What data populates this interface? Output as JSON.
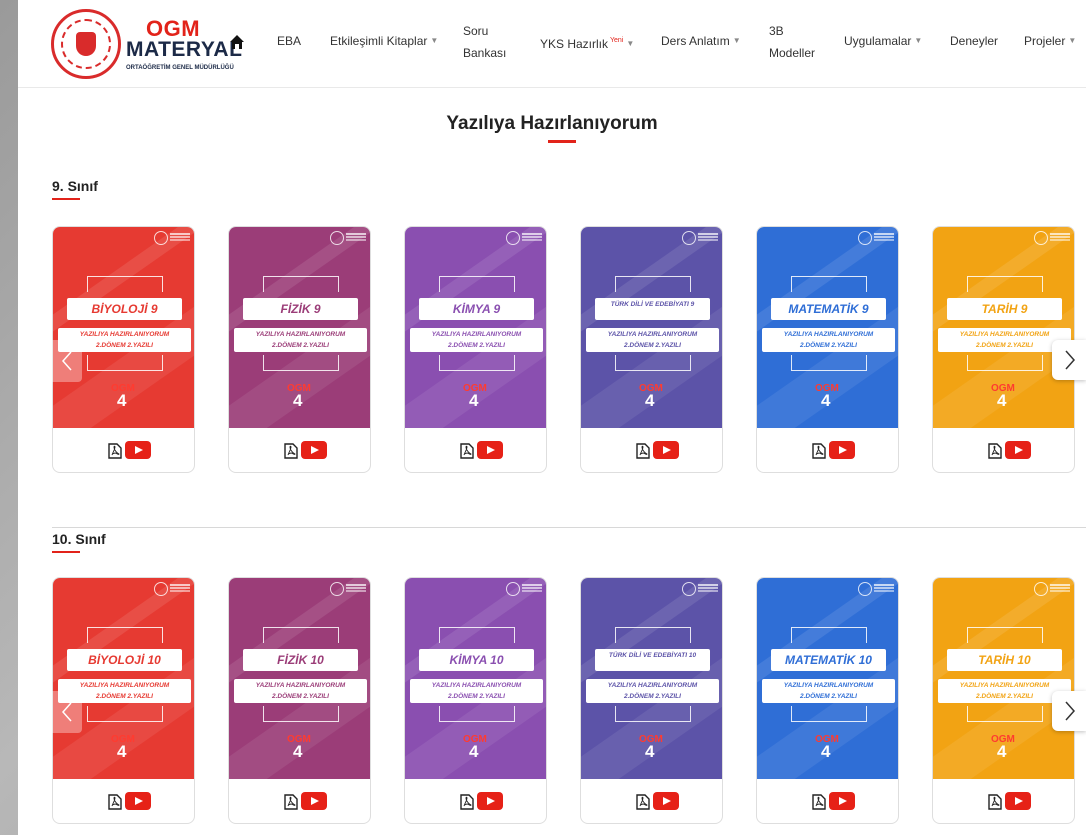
{
  "header": {
    "logo": {
      "brand_top": "OGM",
      "brand_bottom": "MATERYAL",
      "sub": "ORTAÖĞRETİM GENEL MÜDÜRLÜĞÜ"
    },
    "nav": [
      {
        "label": "EBA",
        "dropdown": false
      },
      {
        "label": "Etkileşimli Kitaplar",
        "dropdown": true
      },
      {
        "label_line1": "Soru",
        "label_line2": "Bankası",
        "dropdown": false
      },
      {
        "label": "YKS Hazırlık",
        "badge": "Yeni",
        "dropdown": true
      },
      {
        "label": "Ders Anlatım",
        "dropdown": true
      },
      {
        "label_line1": "3B",
        "label_line2": "Modeller",
        "dropdown": false
      },
      {
        "label": "Uygulamalar",
        "dropdown": true
      },
      {
        "label": "Deneyler",
        "dropdown": false
      },
      {
        "label": "Projeler",
        "dropdown": true
      }
    ]
  },
  "page": {
    "title": "Yazılıya Hazırlanıyorum"
  },
  "sections": [
    {
      "title": "9. Sınıf",
      "cards": [
        {
          "subject": "BİYOLOJİ 9",
          "line1": "YAZILIYA HAZIRLANIYORUM",
          "line2": "2.DÖNEM 2.YAZILI",
          "number": "4",
          "brand": "OGM",
          "color": "#e63a32"
        },
        {
          "subject": "FİZİK 9",
          "line1": "YAZILIYA HAZIRLANIYORUM",
          "line2": "2.DÖNEM 2.YAZILI",
          "number": "4",
          "brand": "OGM",
          "color": "#9b3d78"
        },
        {
          "subject": "KİMYA 9",
          "line1": "YAZILIYA HAZIRLANIYORUM",
          "line2": "2.DÖNEM 2.YAZILI",
          "number": "4",
          "brand": "OGM",
          "color": "#8a4fb0"
        },
        {
          "subject": "TÜRK DİLİ VE EDEBİYATI 9",
          "line1": "YAZILIYA HAZIRLANIYORUM",
          "line2": "2.DÖNEM 2.YAZILI",
          "number": "4",
          "brand": "OGM",
          "color": "#5c53a8"
        },
        {
          "subject": "MATEMATİK 9",
          "line1": "YAZILIYA HAZIRLANIYORUM",
          "line2": "2.DÖNEM 2.YAZILI",
          "number": "4",
          "brand": "OGM",
          "color": "#2f6ed6"
        },
        {
          "subject": "TARİH 9",
          "line1": "YAZILIYA HAZIRLANIYORUM",
          "line2": "2.DÖNEM 2.YAZILI",
          "number": "4",
          "brand": "OGM",
          "color": "#f2a313"
        }
      ]
    },
    {
      "title": "10. Sınıf",
      "cards": [
        {
          "subject": "BİYOLOJİ 10",
          "line1": "YAZILIYA HAZIRLANIYORUM",
          "line2": "2.DÖNEM 2.YAZILI",
          "number": "4",
          "brand": "OGM",
          "color": "#e63a32"
        },
        {
          "subject": "FİZİK 10",
          "line1": "YAZILIYA HAZIRLANIYORUM",
          "line2": "2.DÖNEM 2.YAZILI",
          "number": "4",
          "brand": "OGM",
          "color": "#9b3d78"
        },
        {
          "subject": "KİMYA 10",
          "line1": "YAZILIYA HAZIRLANIYORUM",
          "line2": "2.DÖNEM 2.YAZILI",
          "number": "4",
          "brand": "OGM",
          "color": "#8a4fb0"
        },
        {
          "subject": "TÜRK DİLİ VE EDEBİYATI 10",
          "line1": "YAZILIYA HAZIRLANIYORUM",
          "line2": "2.DÖNEM 2.YAZILI",
          "number": "4",
          "brand": "OGM",
          "color": "#5c53a8"
        },
        {
          "subject": "MATEMATİK 10",
          "line1": "YAZILIYA HAZIRLANIYORUM",
          "line2": "2.DÖNEM 2.YAZILI",
          "number": "4",
          "brand": "OGM",
          "color": "#2f6ed6"
        },
        {
          "subject": "TARİH 10",
          "line1": "YAZILIYA HAZIRLANIYORUM",
          "line2": "2.DÖNEM 2.YAZILI",
          "number": "4",
          "brand": "OGM",
          "color": "#f2a313"
        }
      ]
    }
  ],
  "colors": {
    "accent": "#e2231a",
    "youtube": "#e62117"
  },
  "icons": {
    "home": "home-icon",
    "pdf": "pdf-icon",
    "video": "youtube-icon",
    "prev": "chevron-left-icon",
    "next": "chevron-right-icon"
  }
}
